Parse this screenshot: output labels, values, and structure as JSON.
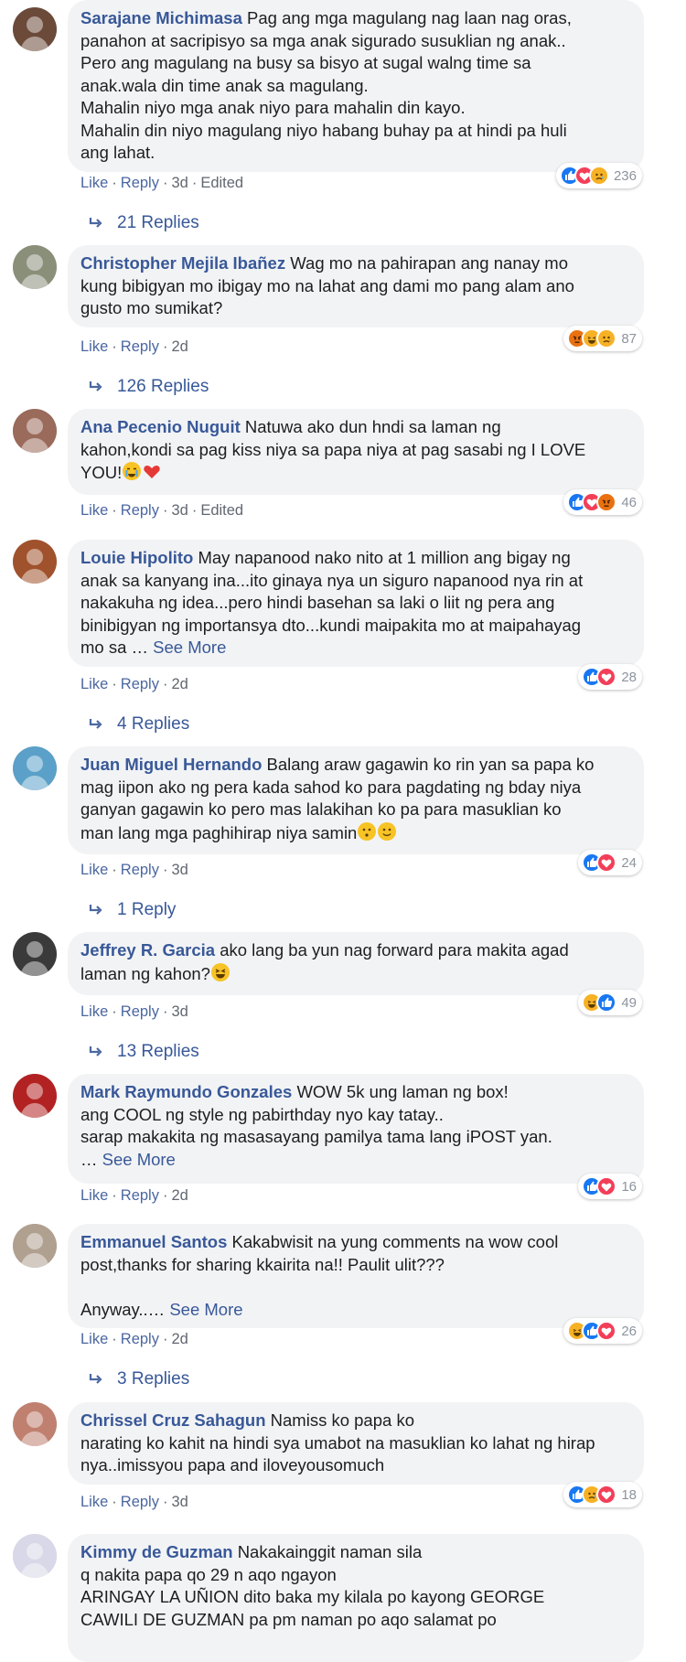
{
  "labels": {
    "like": "Like",
    "reply": "Reply",
    "see_more": "See More"
  },
  "comments": [
    {
      "author": "Sarajane Michimasa",
      "lines": [
        "Pag ang mga magulang nag laan nag oras,",
        "panahon at sacripisyo sa mga anak sigurado susuklian ng anak..",
        "Pero ang magulang na busy sa bisyo at sugal walng time sa",
        "anak.wala din time anak sa magulang.",
        "Mahalin niyo mga anak niyo para mahalin din kayo.",
        "Mahalin din niyo magulang niyo habang buhay pa at hindi pa huli",
        "ang lahat."
      ],
      "time": "3d",
      "edited": "Edited",
      "reactions": [
        "like",
        "love",
        "sad"
      ],
      "reaction_count": "236",
      "replies": "21 Replies",
      "avatar_color": "#6b4a3a"
    },
    {
      "author": "Christopher Mejila Ibañez",
      "lines": [
        "Wag mo na pahirapan ang nanay mo",
        "kung bibigyan mo ibigay mo na lahat ang dami mo pang alam ano",
        "gusto mo sumikat?"
      ],
      "time": "2d",
      "reactions": [
        "angry",
        "haha",
        "sad"
      ],
      "reaction_count": "87",
      "replies": "126 Replies",
      "avatar_color": "#8a8f7a"
    },
    {
      "author": "Ana Pecenio Nuguit",
      "lines": [
        "Natuwa ako dun hndi sa laman ng",
        "kahon,kondi sa pag kiss niya sa papa niya at pag sasabi ng I LOVE",
        "YOU!"
      ],
      "trailing": [
        "crying",
        "heart"
      ],
      "time": "3d",
      "edited": "Edited",
      "reactions": [
        "like",
        "love",
        "angry"
      ],
      "reaction_count": "46",
      "avatar_color": "#9a6a5a"
    },
    {
      "author": "Louie Hipolito",
      "lines": [
        "May napanood nako nito at 1 million ang bigay ng",
        "anak sa kanyang ina...ito ginaya nya un siguro napanood nya rin at",
        "nakakuha ng idea...pero hindi basehan sa laki o liit ng pera ang",
        "binibigyan ng importansya dto...kundi maipakita mo at maipahayag",
        "mo sa …"
      ],
      "see_more": true,
      "time": "2d",
      "reactions": [
        "like",
        "love"
      ],
      "reaction_count": "28",
      "replies": "4 Replies",
      "avatar_color": "#a0522d"
    },
    {
      "author": "Juan Miguel Hernando",
      "lines": [
        "Balang araw gagawin ko rin yan sa papa ko",
        "mag iipon ako ng pera kada sahod ko para pagdating ng bday niya",
        "ganyan gagawin ko pero mas lalakihan ko pa para masuklian ko",
        "man lang mga paghihirap niya samin"
      ],
      "trailing": [
        "neutral",
        "smile"
      ],
      "time": "3d",
      "reactions": [
        "like",
        "love"
      ],
      "reaction_count": "24",
      "replies": "1 Reply",
      "avatar_color": "#5aa0c8"
    },
    {
      "author": "Jeffrey R. Garcia",
      "lines": [
        "ako lang ba yun nag forward para makita agad",
        "laman ng kahon?"
      ],
      "trailing": [
        "laugh"
      ],
      "time": "3d",
      "reactions": [
        "haha",
        "like"
      ],
      "reaction_count": "49",
      "replies": "13 Replies",
      "avatar_color": "#3a3a3a"
    },
    {
      "author": "Mark Raymundo Gonzales",
      "lines": [
        "WOW 5k ung laman ng box!",
        "ang COOL ng style ng pabirthday nyo kay tatay..",
        "sarap makakita ng masasayang pamilya tama lang iPOST yan.",
        "…"
      ],
      "see_more": true,
      "time": "2d",
      "reactions": [
        "like",
        "love"
      ],
      "reaction_count": "16",
      "avatar_color": "#b22222"
    },
    {
      "author": "Emmanuel Santos",
      "lines": [
        "Kakabwisit na yung comments na wow cool",
        "post,thanks for sharing kkairita na!! Paulit ulit???",
        "",
        "Anyway..…"
      ],
      "see_more": true,
      "time": "2d",
      "reactions": [
        "haha",
        "like",
        "love"
      ],
      "reaction_count": "26",
      "replies": "3 Replies",
      "avatar_color": "#b0a090"
    },
    {
      "author": "Chrissel Cruz Sahagun",
      "lines": [
        "Namiss ko papa ko",
        "narating ko kahit na hindi sya umabot na masuklian ko lahat ng hirap",
        "nya..imissyou papa and iloveyousomuch"
      ],
      "time": "3d",
      "reactions": [
        "like",
        "sad",
        "love"
      ],
      "reaction_count": "18",
      "avatar_color": "#c08070"
    },
    {
      "author": "Kimmy de Guzman",
      "lines": [
        "Nakakainggit naman sila",
        "q nakita papa qo 29 n aqo ngayon",
        "ARINGAY LA UÑION dito baka my kilala po kayong GEORGE",
        "CAWILI DE GUZMAN pa pm naman po aqo salamat po"
      ],
      "avatar_color": "#d8d8e8"
    }
  ],
  "colors": {
    "link": "#385898",
    "meta": "#606770",
    "bubble": "#f2f3f5",
    "like": "#1877f2",
    "love": "#f33e58",
    "emoji": "#f7b125"
  }
}
